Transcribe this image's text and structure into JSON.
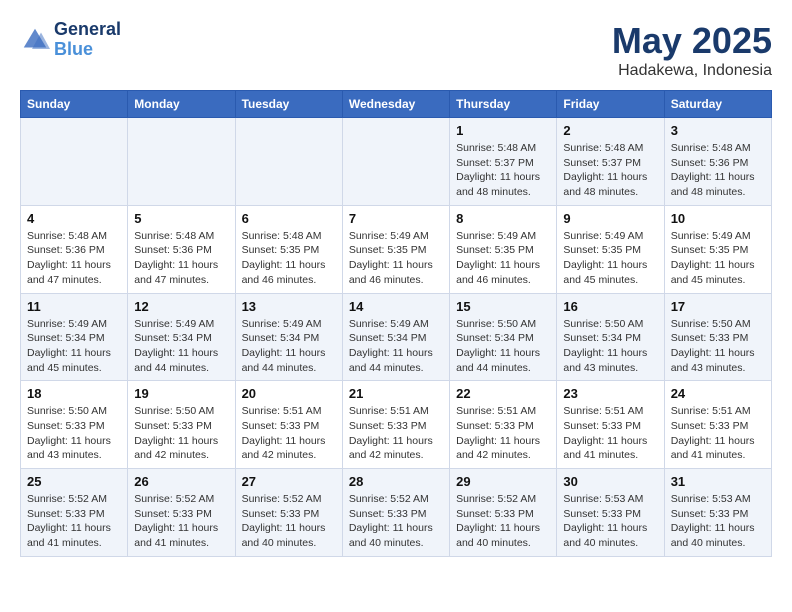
{
  "header": {
    "logo_line1": "General",
    "logo_line2": "Blue",
    "month": "May 2025",
    "location": "Hadakewa, Indonesia"
  },
  "weekdays": [
    "Sunday",
    "Monday",
    "Tuesday",
    "Wednesday",
    "Thursday",
    "Friday",
    "Saturday"
  ],
  "weeks": [
    [
      {
        "day": "",
        "info": ""
      },
      {
        "day": "",
        "info": ""
      },
      {
        "day": "",
        "info": ""
      },
      {
        "day": "",
        "info": ""
      },
      {
        "day": "1",
        "info": "Sunrise: 5:48 AM\nSunset: 5:37 PM\nDaylight: 11 hours and 48 minutes."
      },
      {
        "day": "2",
        "info": "Sunrise: 5:48 AM\nSunset: 5:37 PM\nDaylight: 11 hours and 48 minutes."
      },
      {
        "day": "3",
        "info": "Sunrise: 5:48 AM\nSunset: 5:36 PM\nDaylight: 11 hours and 48 minutes."
      }
    ],
    [
      {
        "day": "4",
        "info": "Sunrise: 5:48 AM\nSunset: 5:36 PM\nDaylight: 11 hours and 47 minutes."
      },
      {
        "day": "5",
        "info": "Sunrise: 5:48 AM\nSunset: 5:36 PM\nDaylight: 11 hours and 47 minutes."
      },
      {
        "day": "6",
        "info": "Sunrise: 5:48 AM\nSunset: 5:35 PM\nDaylight: 11 hours and 46 minutes."
      },
      {
        "day": "7",
        "info": "Sunrise: 5:49 AM\nSunset: 5:35 PM\nDaylight: 11 hours and 46 minutes."
      },
      {
        "day": "8",
        "info": "Sunrise: 5:49 AM\nSunset: 5:35 PM\nDaylight: 11 hours and 46 minutes."
      },
      {
        "day": "9",
        "info": "Sunrise: 5:49 AM\nSunset: 5:35 PM\nDaylight: 11 hours and 45 minutes."
      },
      {
        "day": "10",
        "info": "Sunrise: 5:49 AM\nSunset: 5:35 PM\nDaylight: 11 hours and 45 minutes."
      }
    ],
    [
      {
        "day": "11",
        "info": "Sunrise: 5:49 AM\nSunset: 5:34 PM\nDaylight: 11 hours and 45 minutes."
      },
      {
        "day": "12",
        "info": "Sunrise: 5:49 AM\nSunset: 5:34 PM\nDaylight: 11 hours and 44 minutes."
      },
      {
        "day": "13",
        "info": "Sunrise: 5:49 AM\nSunset: 5:34 PM\nDaylight: 11 hours and 44 minutes."
      },
      {
        "day": "14",
        "info": "Sunrise: 5:49 AM\nSunset: 5:34 PM\nDaylight: 11 hours and 44 minutes."
      },
      {
        "day": "15",
        "info": "Sunrise: 5:50 AM\nSunset: 5:34 PM\nDaylight: 11 hours and 44 minutes."
      },
      {
        "day": "16",
        "info": "Sunrise: 5:50 AM\nSunset: 5:34 PM\nDaylight: 11 hours and 43 minutes."
      },
      {
        "day": "17",
        "info": "Sunrise: 5:50 AM\nSunset: 5:33 PM\nDaylight: 11 hours and 43 minutes."
      }
    ],
    [
      {
        "day": "18",
        "info": "Sunrise: 5:50 AM\nSunset: 5:33 PM\nDaylight: 11 hours and 43 minutes."
      },
      {
        "day": "19",
        "info": "Sunrise: 5:50 AM\nSunset: 5:33 PM\nDaylight: 11 hours and 42 minutes."
      },
      {
        "day": "20",
        "info": "Sunrise: 5:51 AM\nSunset: 5:33 PM\nDaylight: 11 hours and 42 minutes."
      },
      {
        "day": "21",
        "info": "Sunrise: 5:51 AM\nSunset: 5:33 PM\nDaylight: 11 hours and 42 minutes."
      },
      {
        "day": "22",
        "info": "Sunrise: 5:51 AM\nSunset: 5:33 PM\nDaylight: 11 hours and 42 minutes."
      },
      {
        "day": "23",
        "info": "Sunrise: 5:51 AM\nSunset: 5:33 PM\nDaylight: 11 hours and 41 minutes."
      },
      {
        "day": "24",
        "info": "Sunrise: 5:51 AM\nSunset: 5:33 PM\nDaylight: 11 hours and 41 minutes."
      }
    ],
    [
      {
        "day": "25",
        "info": "Sunrise: 5:52 AM\nSunset: 5:33 PM\nDaylight: 11 hours and 41 minutes."
      },
      {
        "day": "26",
        "info": "Sunrise: 5:52 AM\nSunset: 5:33 PM\nDaylight: 11 hours and 41 minutes."
      },
      {
        "day": "27",
        "info": "Sunrise: 5:52 AM\nSunset: 5:33 PM\nDaylight: 11 hours and 40 minutes."
      },
      {
        "day": "28",
        "info": "Sunrise: 5:52 AM\nSunset: 5:33 PM\nDaylight: 11 hours and 40 minutes."
      },
      {
        "day": "29",
        "info": "Sunrise: 5:52 AM\nSunset: 5:33 PM\nDaylight: 11 hours and 40 minutes."
      },
      {
        "day": "30",
        "info": "Sunrise: 5:53 AM\nSunset: 5:33 PM\nDaylight: 11 hours and 40 minutes."
      },
      {
        "day": "31",
        "info": "Sunrise: 5:53 AM\nSunset: 5:33 PM\nDaylight: 11 hours and 40 minutes."
      }
    ]
  ]
}
